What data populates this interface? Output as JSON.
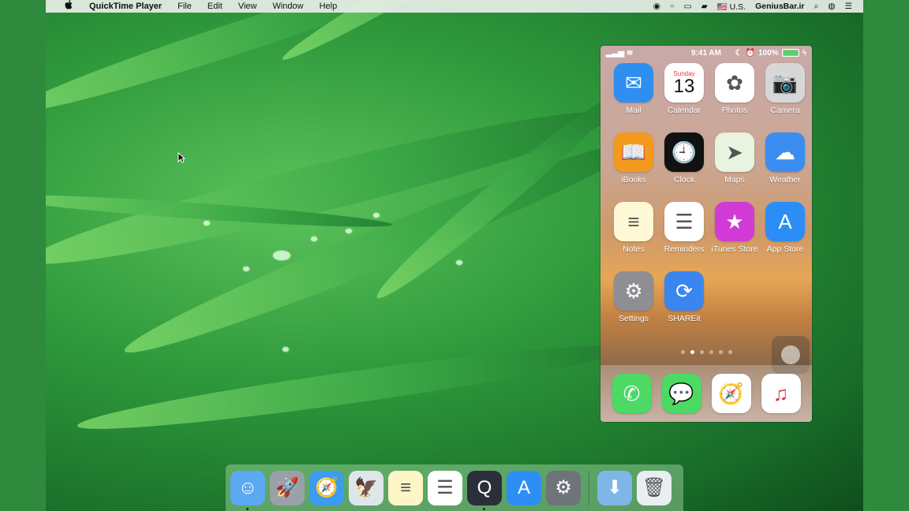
{
  "menubar": {
    "apple": "",
    "app_name": "QuickTime Player",
    "menus": [
      "File",
      "Edit",
      "View",
      "Window",
      "Help"
    ],
    "input_source": "U.S.",
    "user_name": "GeniusBar.ir"
  },
  "phone": {
    "status": {
      "time": "9:41 AM",
      "battery": "100%"
    },
    "apps": [
      {
        "label": "Mail",
        "color": "#2f8ff0",
        "glyph": "✉"
      },
      {
        "label": "Calendar",
        "color": "#ffffff",
        "glyph": "13",
        "day": "Sunday"
      },
      {
        "label": "Photos",
        "color": "#ffffff",
        "glyph": "✿"
      },
      {
        "label": "Camera",
        "color": "#d7d7d7",
        "glyph": "📷"
      },
      {
        "label": "iBooks",
        "color": "#f39a1e",
        "glyph": "📖"
      },
      {
        "label": "Clock",
        "color": "#111111",
        "glyph": "🕘"
      },
      {
        "label": "Maps",
        "color": "#e8f3e0",
        "glyph": "➤"
      },
      {
        "label": "Weather",
        "color": "#3b8ef0",
        "glyph": "☁"
      },
      {
        "label": "Notes",
        "color": "#fff8d6",
        "glyph": "≡"
      },
      {
        "label": "Reminders",
        "color": "#ffffff",
        "glyph": "☰"
      },
      {
        "label": "iTunes Store",
        "color": "#d23ad6",
        "glyph": "★"
      },
      {
        "label": "App Store",
        "color": "#2b8ef7",
        "glyph": "A"
      },
      {
        "label": "Settings",
        "color": "#8e8e93",
        "glyph": "⚙"
      },
      {
        "label": "SHAREit",
        "color": "#3a86f0",
        "glyph": "⟳"
      }
    ],
    "dock_apps": [
      {
        "name": "phone",
        "color": "#4cd964",
        "glyph": "✆"
      },
      {
        "name": "messages",
        "color": "#4cd964",
        "glyph": "💬"
      },
      {
        "name": "safari",
        "color": "#ffffff",
        "glyph": "🧭"
      },
      {
        "name": "music",
        "color": "#ffffff",
        "glyph": "♫"
      }
    ]
  },
  "mac_dock": [
    {
      "name": "finder",
      "color": "#5aa9f2",
      "glyph": "☺",
      "running": true
    },
    {
      "name": "launchpad",
      "color": "#9aa0a8",
      "glyph": "🚀",
      "running": false
    },
    {
      "name": "safari",
      "color": "#3b9cf0",
      "glyph": "🧭",
      "running": false
    },
    {
      "name": "mail",
      "color": "#dfe6ea",
      "glyph": "🦅",
      "running": false
    },
    {
      "name": "notes",
      "color": "#fff6c8",
      "glyph": "≡",
      "running": false
    },
    {
      "name": "reminders",
      "color": "#ffffff",
      "glyph": "☰",
      "running": false
    },
    {
      "name": "quicktime",
      "color": "#2a2f3a",
      "glyph": "Q",
      "running": true
    },
    {
      "name": "app-store",
      "color": "#2d8ff5",
      "glyph": "A",
      "running": false
    },
    {
      "name": "system-preferences",
      "color": "#6f737a",
      "glyph": "⚙",
      "running": false
    },
    {
      "name": "downloads",
      "color": "#7fb6e8",
      "glyph": "⬇",
      "running": false
    },
    {
      "name": "trash",
      "color": "#e8eef2",
      "glyph": "🗑",
      "running": false
    }
  ]
}
